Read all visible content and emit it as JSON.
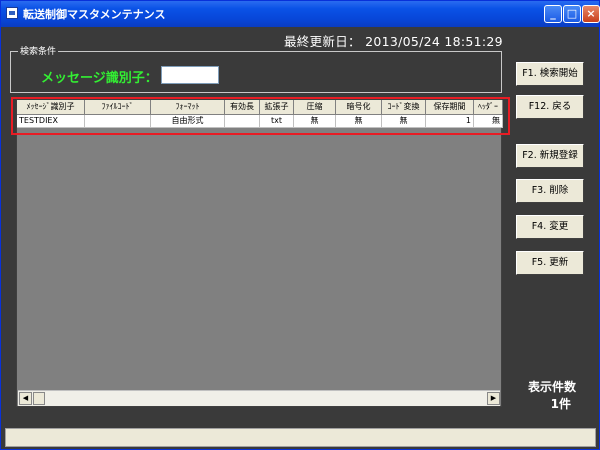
{
  "window": {
    "title": "転送制御マスタメンテナンス"
  },
  "header": {
    "last_updated": "最終更新日： 2013/05/24 18:51:29"
  },
  "search": {
    "group_label": "検索条件",
    "label": "メッセージ識別子：",
    "value": ""
  },
  "grid": {
    "columns": [
      "ﾒｯｾｰｼﾞ識別子",
      "ﾌｧｲﾙｺｰﾄﾞ",
      "ﾌｫｰﾏｯﾄ",
      "有効長",
      "拡張子",
      "圧縮",
      "暗号化",
      "ｺｰﾄﾞ変換",
      "保存期間",
      "ﾍｯﾀﾞｰ"
    ],
    "rows": [
      [
        "TESTDIEX",
        "",
        "自由形式",
        "",
        "txt",
        "無",
        "無",
        "無",
        "1",
        "無"
      ]
    ]
  },
  "buttons": {
    "f1": "F1. 検索開始",
    "f12": "F12. 戻る",
    "f2": "F2. 新規登録",
    "f3": "F3. 削除",
    "f4": "F4. 変更",
    "f5": "F5. 更新"
  },
  "count": {
    "label": "表示件数",
    "value": "1件"
  },
  "colors": {
    "window_bg": "#3a3a3a",
    "grid_bg": "#808080",
    "label_green": "#33ee33",
    "highlight_red": "#e81c24"
  }
}
